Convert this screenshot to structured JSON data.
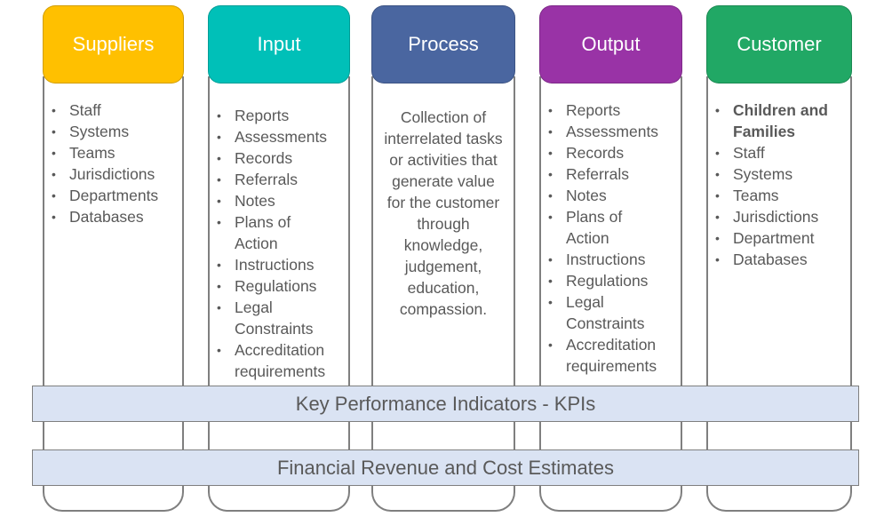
{
  "columns": [
    {
      "title": "Suppliers",
      "color": "#ffc000",
      "items": [
        "Staff",
        "Systems",
        "Teams",
        "Jurisdictions",
        "Departments",
        "Databases"
      ]
    },
    {
      "title": "Input",
      "color": "#00c0b8",
      "items": [
        "Reports",
        "Assessments",
        "Records",
        "Referrals",
        "Notes",
        "Plans of Action",
        "Instructions",
        "Regulations",
        "Legal Constraints",
        "Accreditation requirements"
      ]
    },
    {
      "title": "Process",
      "color": "#4a66a0",
      "description": "Collection of interrelated tasks or activities that generate value for the customer through knowledge, judgement, education, compassion."
    },
    {
      "title": "Output",
      "color": "#9933a6",
      "items": [
        "Reports",
        "Assessments",
        "Records",
        "Referrals",
        "Notes",
        "Plans of Action",
        "Instructions",
        "Regulations",
        "Legal Constraints",
        "Accreditation requirements"
      ]
    },
    {
      "title": "Customer",
      "color": "#21a865",
      "items": [
        "Children and Families",
        "Staff",
        "Systems",
        "Teams",
        "Jurisdictions",
        "Department",
        "Databases"
      ],
      "bold_items": [
        "Children and Families"
      ]
    }
  ],
  "bands": {
    "kpi": "Key Performance Indicators - KPIs",
    "financial": "Financial Revenue and Cost Estimates"
  }
}
